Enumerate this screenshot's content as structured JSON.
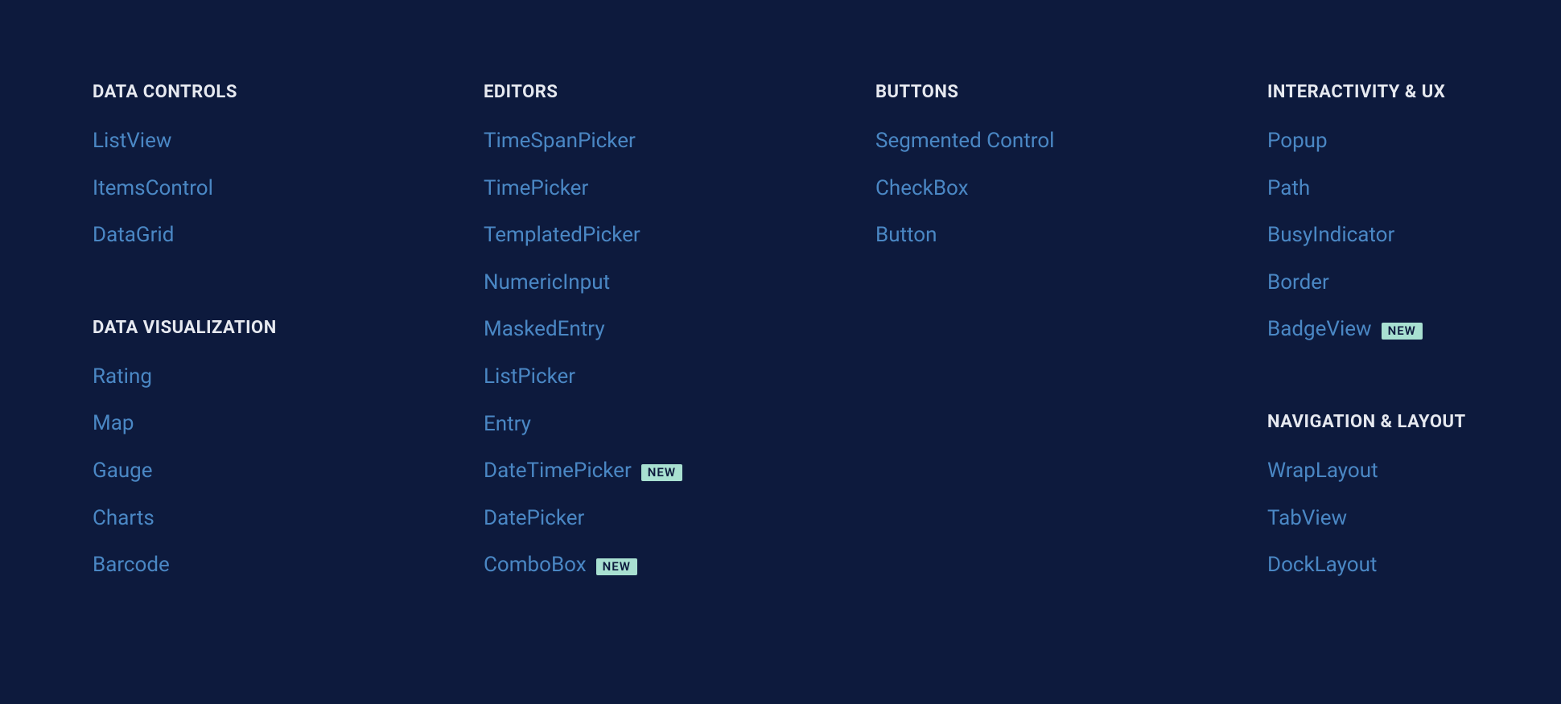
{
  "badge_text": "NEW",
  "columns": [
    {
      "sections": [
        {
          "key": "data-controls",
          "title": "DATA CONTROLS",
          "items": [
            {
              "label": "ListView",
              "badge": false
            },
            {
              "label": "ItemsControl",
              "badge": false
            },
            {
              "label": "DataGrid",
              "badge": false
            }
          ]
        },
        {
          "key": "data-visualization",
          "title": "DATA VISUALIZATION",
          "items": [
            {
              "label": "Rating",
              "badge": false
            },
            {
              "label": "Map",
              "badge": false
            },
            {
              "label": "Gauge",
              "badge": false
            },
            {
              "label": "Charts",
              "badge": false
            },
            {
              "label": "Barcode",
              "badge": false
            }
          ]
        }
      ]
    },
    {
      "sections": [
        {
          "key": "editors",
          "title": "EDITORS",
          "items": [
            {
              "label": "TimeSpanPicker",
              "badge": false
            },
            {
              "label": "TimePicker",
              "badge": false
            },
            {
              "label": "TemplatedPicker",
              "badge": false
            },
            {
              "label": "NumericInput",
              "badge": false
            },
            {
              "label": "MaskedEntry",
              "badge": false
            },
            {
              "label": "ListPicker",
              "badge": false
            },
            {
              "label": "Entry",
              "badge": false
            },
            {
              "label": "DateTimePicker",
              "badge": true
            },
            {
              "label": "DatePicker",
              "badge": false
            },
            {
              "label": "ComboBox",
              "badge": true
            }
          ]
        }
      ]
    },
    {
      "sections": [
        {
          "key": "buttons",
          "title": "BUTTONS",
          "items": [
            {
              "label": "Segmented Control",
              "badge": false
            },
            {
              "label": "CheckBox",
              "badge": false
            },
            {
              "label": "Button",
              "badge": false
            }
          ]
        }
      ]
    },
    {
      "sections": [
        {
          "key": "interactivity-ux",
          "title": "INTERACTIVITY & UX",
          "items": [
            {
              "label": "Popup",
              "badge": false
            },
            {
              "label": "Path",
              "badge": false
            },
            {
              "label": "BusyIndicator",
              "badge": false
            },
            {
              "label": "Border",
              "badge": false
            },
            {
              "label": "BadgeView",
              "badge": true
            }
          ]
        },
        {
          "key": "navigation-layout",
          "title": "NAVIGATION & LAYOUT",
          "items": [
            {
              "label": "WrapLayout",
              "badge": false
            },
            {
              "label": "TabView",
              "badge": false
            },
            {
              "label": "DockLayout",
              "badge": false
            }
          ]
        }
      ]
    }
  ]
}
